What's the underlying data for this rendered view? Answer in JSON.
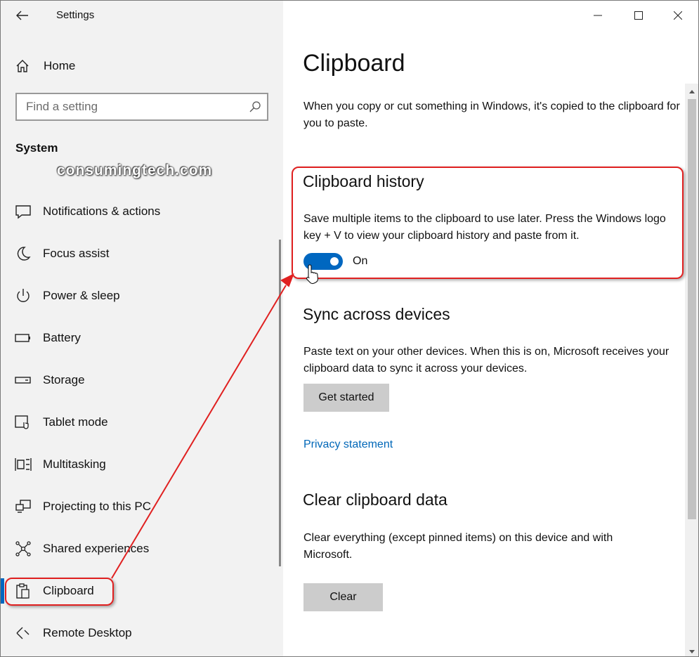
{
  "window": {
    "app_title": "Settings",
    "controls": {
      "minimize": "minimize-icon",
      "maximize": "maximize-icon",
      "close": "close-icon"
    }
  },
  "sidebar": {
    "home_label": "Home",
    "search_placeholder": "Find a setting",
    "section_title": "System",
    "watermark": "consumingtech.com",
    "items": [
      {
        "label": "Notifications & actions",
        "icon": "notification-icon"
      },
      {
        "label": "Focus assist",
        "icon": "moon-icon"
      },
      {
        "label": "Power & sleep",
        "icon": "power-icon"
      },
      {
        "label": "Battery",
        "icon": "battery-icon"
      },
      {
        "label": "Storage",
        "icon": "storage-icon"
      },
      {
        "label": "Tablet mode",
        "icon": "tablet-icon"
      },
      {
        "label": "Multitasking",
        "icon": "multitasking-icon"
      },
      {
        "label": "Projecting to this PC",
        "icon": "projecting-icon"
      },
      {
        "label": "Shared experiences",
        "icon": "shared-icon"
      },
      {
        "label": "Clipboard",
        "icon": "clipboard-icon",
        "selected": true
      },
      {
        "label": "Remote Desktop",
        "icon": "remote-desktop-icon"
      }
    ]
  },
  "main": {
    "title": "Clipboard",
    "intro": "When you copy or cut something in Windows, it's copied to the clipboard for you to paste.",
    "history": {
      "heading": "Clipboard history",
      "description": "Save multiple items to the clipboard to use later. Press the Windows logo key + V to view your clipboard history and paste from it.",
      "toggle_state": "On",
      "toggle_on": true
    },
    "sync": {
      "heading": "Sync across devices",
      "description": "Paste text on your other devices. When this is on, Microsoft receives your clipboard data to sync it across your devices.",
      "button": "Get started",
      "link": "Privacy statement"
    },
    "clear": {
      "heading": "Clear clipboard data",
      "description": "Clear everything (except pinned items) on this device and with Microsoft.",
      "button": "Clear"
    }
  },
  "colors": {
    "accent": "#0067c0",
    "annotation": "#e02020",
    "link": "#0067b8",
    "sidebar_bg": "#f2f2f2",
    "button_bg": "#cccccc"
  }
}
